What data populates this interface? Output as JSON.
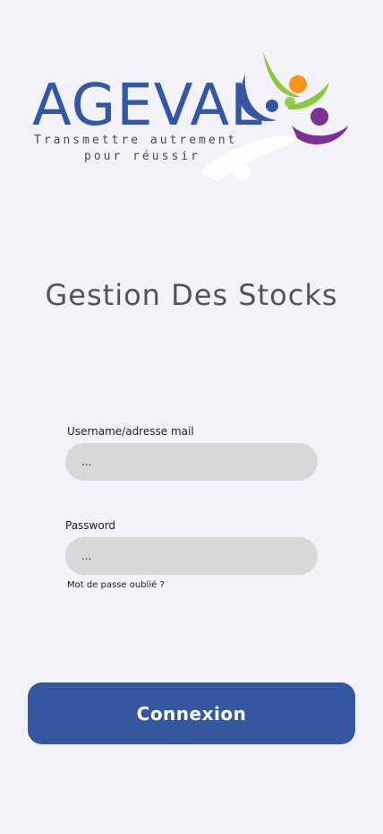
{
  "logo": {
    "brand": "AGEVAL",
    "tagline_line1": "Transmettre autrement",
    "tagline_line2": "pour réussir"
  },
  "page_title": "Gestion Des Stocks",
  "login_form": {
    "username_label": "Username/adresse mail",
    "username_value": "...",
    "password_label": "Password",
    "password_value": "...",
    "forgot_password": "Mot de passe oublié ?",
    "submit_label": "Connexion"
  },
  "colors": {
    "background": "#f2f2f8",
    "brand_blue": "#3456a3",
    "field_bg": "#d8d8d8",
    "logo_green": "#8dc63f",
    "logo_orange": "#f7941d",
    "logo_purple": "#7b3294"
  }
}
